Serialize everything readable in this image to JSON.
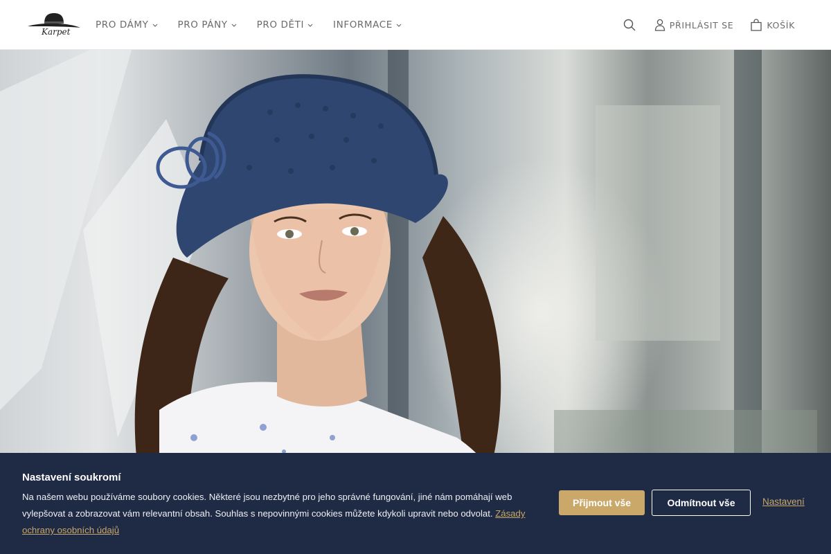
{
  "header": {
    "logo_text": "Karpet",
    "nav": [
      {
        "label": "PRO DÁMY"
      },
      {
        "label": "PRO PÁNY"
      },
      {
        "label": "PRO DĚTI"
      },
      {
        "label": "INFORMACE"
      }
    ],
    "login_label": "PŘIHLÁSIT SE",
    "cart_label": "KOŠÍK"
  },
  "cookie": {
    "title": "Nastavení soukromí",
    "text": "Na našem webu používáme soubory cookies. Některé jsou nezbytné pro jeho správné fungování, jiné nám pomáhají web vylepšovat a zobrazovat vám relevantní obsah. Souhlas s nepovinnými cookies můžete kdykoli upravit nebo odvolat.",
    "policy_link": "Zásady ochrany osobních údajů",
    "accept_label": "Přijmout vše",
    "reject_label": "Odmítnout vše",
    "settings_label": "Nastavení"
  },
  "colors": {
    "accent": "#c9a86a",
    "cookie_bg": "#1f2a44",
    "nav_text": "#6b6b6b"
  },
  "icons": [
    "search-icon",
    "user-icon",
    "bag-icon",
    "chevron-down-icon"
  ]
}
